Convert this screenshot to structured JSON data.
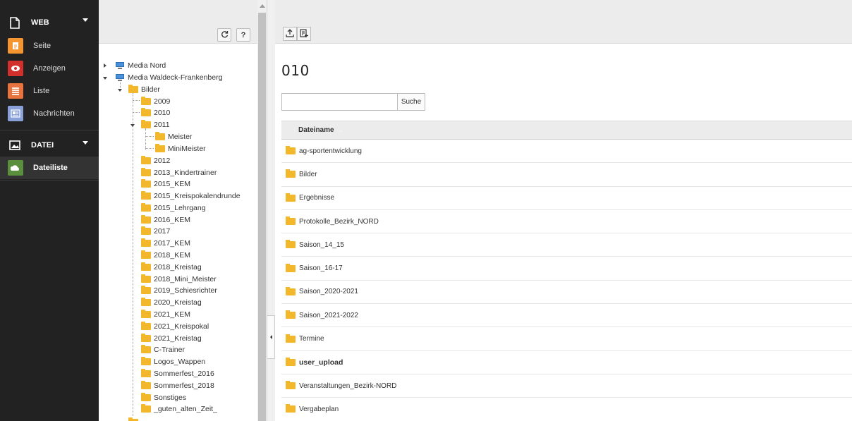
{
  "module_menu": {
    "web_group": {
      "label": "WEB",
      "icon": "page-icon"
    },
    "web_modules": [
      {
        "label": "Seite",
        "icon": "page-module-icon",
        "color": "#f49530"
      },
      {
        "label": "Anzeigen",
        "icon": "eye-icon",
        "color": "#d1302d"
      },
      {
        "label": "Liste",
        "icon": "list-icon",
        "color": "#e7743f"
      },
      {
        "label": "Nachrichten",
        "icon": "news-icon",
        "color": "#8aa0d8"
      }
    ],
    "file_group": {
      "label": "DATEI",
      "icon": "image-icon"
    },
    "file_modules": [
      {
        "label": "Dateiliste",
        "icon": "folder-cloud-icon",
        "color": "#5a8f3d",
        "active": true
      }
    ]
  },
  "tree": {
    "toolbar": {
      "refresh_icon": "refresh-icon",
      "help_label": "?"
    },
    "nodes": {
      "media_nord": "Media Nord",
      "media_waldeck": "Media Waldeck-Frankenberg",
      "bilder": "Bilder",
      "y2009": "2009",
      "y2010": "2010",
      "y2011": "2011",
      "meister": "Meister",
      "minimeister": "MiniMeister",
      "y2012": "2012",
      "f01": "2013_Kindertrainer",
      "f02": "2015_KEM",
      "f03": "2015_Kreispokalendrunde",
      "f04": "2015_Lehrgang",
      "f05": "2016_KEM",
      "f06": "2017",
      "f07": "2017_KEM",
      "f08": "2018_KEM",
      "f09": "2018_Kreistag",
      "f10": "2018_Mini_Meister",
      "f11": "2019_Schiesrichter",
      "f12": "2020_Kreistag",
      "f13": "2021_KEM",
      "f14": "2021_Kreispokal",
      "f15": "2021_Kreistag",
      "f16": "C-Trainer",
      "f17": "Logos_Wappen",
      "f18": "Sommerfest_2016",
      "f19": "Sommerfest_2018",
      "f20": "Sonstiges",
      "f21": "_guten_alten_Zeit_"
    }
  },
  "content": {
    "toolbar": {
      "upload_icon": "upload-icon",
      "new_icon": "new-file-icon"
    },
    "title": "010",
    "search": {
      "value": "",
      "placeholder": "",
      "button": "Suche"
    },
    "table": {
      "column_header": "Dateiname",
      "rows": [
        "ag-sportentwicklung",
        "Bilder",
        "Ergebnisse",
        "Protokolle_Bezirk_NORD",
        "Saison_14_15",
        "Saison_16-17",
        "Saison_2020-2021",
        "Saison_2021-2022",
        "Termine",
        "user_upload",
        "Veranstaltungen_Bezirk-NORD",
        "Vergabeplan"
      ]
    }
  }
}
